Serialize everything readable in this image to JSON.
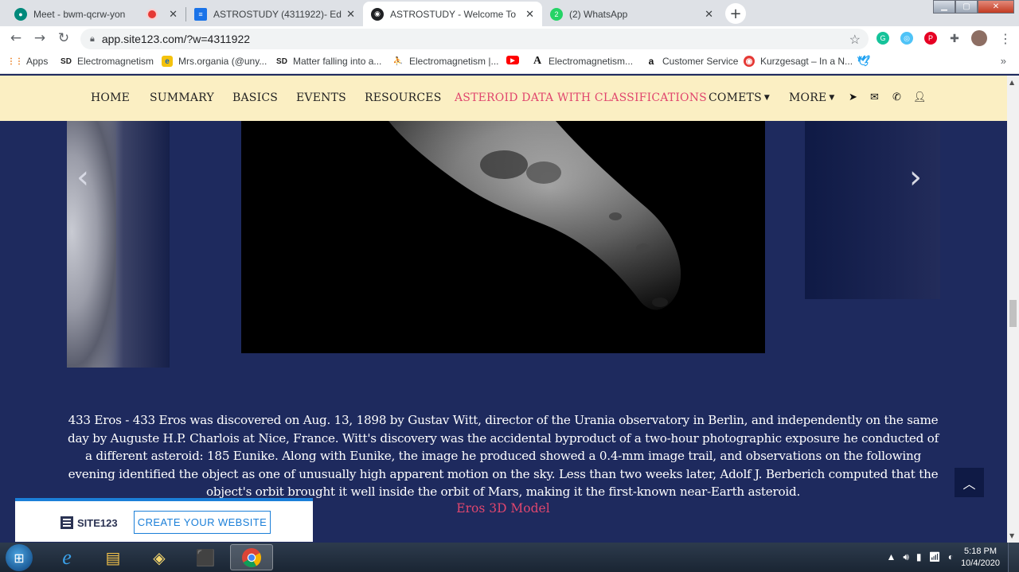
{
  "browser": {
    "tabs": [
      {
        "title": "Meet - bwm-qcrw-yon",
        "icon": "google-meet-icon",
        "recording": true
      },
      {
        "title": "ASTROSTUDY (4311922)- Editor -",
        "icon": "site123-editor-icon"
      },
      {
        "title": "ASTROSTUDY - Welcome To",
        "icon": "alien-icon",
        "active": true
      },
      {
        "title": "(2) WhatsApp",
        "icon": "whatsapp-icon",
        "badge": "2"
      }
    ],
    "new_tab": "+",
    "url": "app.site123.com/?w=4311922"
  },
  "bookmarks": [
    {
      "label": "Apps",
      "icon": "apps-grid-icon"
    },
    {
      "label": "Electromagnetism",
      "icon": "sd-icon"
    },
    {
      "label": "Mrs.organia (@uny...",
      "icon": "edge-e-icon"
    },
    {
      "label": "Matter falling into a...",
      "icon": "sd-icon"
    },
    {
      "label": "Electromagnetism |...",
      "icon": "figure-icon"
    },
    {
      "label": "",
      "icon": "youtube-icon"
    },
    {
      "label": "Electromagnetism...",
      "icon": "letter-a-icon"
    },
    {
      "label": "Customer Service",
      "icon": "amazon-icon"
    },
    {
      "label": "Kurzgesagt – In a N...",
      "icon": "kurzgesagt-icon"
    },
    {
      "label": "",
      "icon": "twitter-icon"
    }
  ],
  "site_nav": {
    "items": [
      "HOME",
      "SUMMARY",
      "BASICS",
      "EVENTS",
      "RESOURCES",
      "ASTEROID DATA WITH CLASSIFICATIONS",
      "COMETS",
      "MORE"
    ],
    "active": "ASTEROID DATA WITH CLASSIFICATIONS",
    "icons": [
      "send-icon",
      "envelope-icon",
      "phone-icon",
      "user-icon"
    ]
  },
  "carousel": {
    "prev": "‹",
    "next": "›"
  },
  "description": "433 Eros - 433 Eros was discovered on Aug. 13, 1898 by Gustav Witt, director of the Urania observatory in Berlin, and independently on the same day by Auguste H.P. Charlois at Nice, France. Witt's discovery was the accidental byproduct of a two-hour photographic exposure he conducted of a different asteroid: 185 Eunike. Along with Eunike, the image he produced showed a 0.4-mm image trail, and observations on the following evening identified the object as one of unusually high apparent motion on the sky. Less than two weeks later, Adolf J. Berberich computed that the object's orbit brought it well inside the orbit of Mars, making it the first-known near-Earth asteroid.",
  "model_link": "Eros 3D Model",
  "banner": {
    "brand": "SITE123",
    "cta": "CREATE YOUR WEBSITE"
  },
  "taskbar": {
    "time": "5:18 PM",
    "date": "10/4/2020"
  },
  "colors": {
    "page_bg": "#1e2a5e",
    "nav_bg": "#fbefc3",
    "accent": "#e0466e",
    "banner_accent": "#1b7fd8"
  }
}
